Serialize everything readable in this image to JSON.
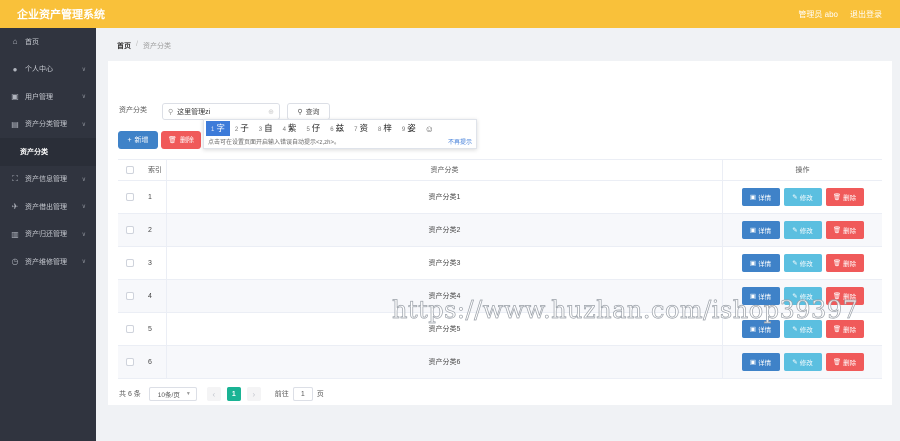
{
  "header": {
    "title": "企业资产管理系统",
    "user_label": "管理员 abo",
    "logout_label": "退出登录"
  },
  "sidebar": {
    "items": [
      {
        "label": "首页",
        "icon": "home-icon",
        "glyph": "⌂",
        "chevron": false
      },
      {
        "label": "个人中心",
        "icon": "user-icon",
        "glyph": "●",
        "chevron": true
      },
      {
        "label": "用户管理",
        "icon": "users-icon",
        "glyph": "▣",
        "chevron": true
      },
      {
        "label": "资产分类管理",
        "icon": "category-icon",
        "glyph": "▤",
        "chevron": true
      },
      {
        "label": "资产分类",
        "icon": "",
        "glyph": "",
        "chevron": false,
        "sub": true
      },
      {
        "label": "资产信息管理",
        "icon": "info-icon",
        "glyph": "⛶",
        "chevron": true
      },
      {
        "label": "资产借出管理",
        "icon": "send-icon",
        "glyph": "✈",
        "chevron": true
      },
      {
        "label": "资产归还管理",
        "icon": "return-icon",
        "glyph": "▥",
        "chevron": true
      },
      {
        "label": "资产维修管理",
        "icon": "repair-icon",
        "glyph": "◷",
        "chevron": true
      }
    ]
  },
  "breadcrumb": {
    "home": "首页",
    "separator": "/",
    "current": "资产分类"
  },
  "search": {
    "label": "资产分类",
    "value": "这里管理zi",
    "query_label": "查询"
  },
  "ime": {
    "candidates": [
      {
        "num": "1",
        "char": "字"
      },
      {
        "num": "2",
        "char": "子"
      },
      {
        "num": "3",
        "char": "自"
      },
      {
        "num": "4",
        "char": "紫"
      },
      {
        "num": "5",
        "char": "仔"
      },
      {
        "num": "6",
        "char": "兹"
      },
      {
        "num": "7",
        "char": "资"
      },
      {
        "num": "8",
        "char": "梓"
      },
      {
        "num": "9",
        "char": "姿"
      }
    ],
    "hint": "点击可在设置页面开启输入错误自动提示<z,zh>。",
    "dismiss": "不再提示"
  },
  "actions": {
    "add_label": "新增",
    "delete_label": "删除"
  },
  "table": {
    "headers": {
      "index": "索引",
      "name": "资产分类",
      "ops": "操作"
    },
    "op_labels": {
      "detail": "详情",
      "edit": "修改",
      "remove": "删除"
    },
    "rows": [
      {
        "index": "1",
        "name": "资产分类1"
      },
      {
        "index": "2",
        "name": "资产分类2"
      },
      {
        "index": "3",
        "name": "资产分类3"
      },
      {
        "index": "4",
        "name": "资产分类4"
      },
      {
        "index": "5",
        "name": "资产分类5"
      },
      {
        "index": "6",
        "name": "资产分类6"
      }
    ]
  },
  "pagination": {
    "total": "共 6 条",
    "page_size": "10条/页",
    "current_page": "1",
    "goto_label": "前往",
    "goto_value": "1",
    "page_unit": "页"
  },
  "watermark": "https://www.huzhan.com/ishop39397",
  "colors": {
    "header": "#f9c13a",
    "sidebar": "#30343f",
    "primary": "#3f82c8",
    "info": "#5bbfe0",
    "danger": "#f05a5a",
    "pager_active": "#1ab394"
  }
}
